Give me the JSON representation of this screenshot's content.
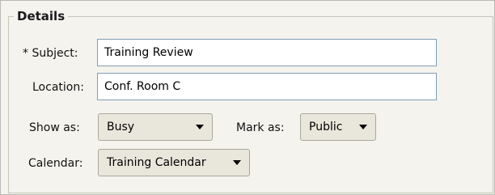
{
  "group_title": "Details",
  "subject": {
    "label": "* Subject:",
    "value": "Training Review"
  },
  "location": {
    "label": "Location:",
    "value": "Conf. Room C"
  },
  "show_as": {
    "label": "Show as:",
    "value": "Busy"
  },
  "mark_as": {
    "label": "Mark as:",
    "value": "Public"
  },
  "calendar": {
    "label": "Calendar:",
    "value": "Training Calendar"
  },
  "icons": {
    "dropdown": "chevron-down-icon"
  }
}
